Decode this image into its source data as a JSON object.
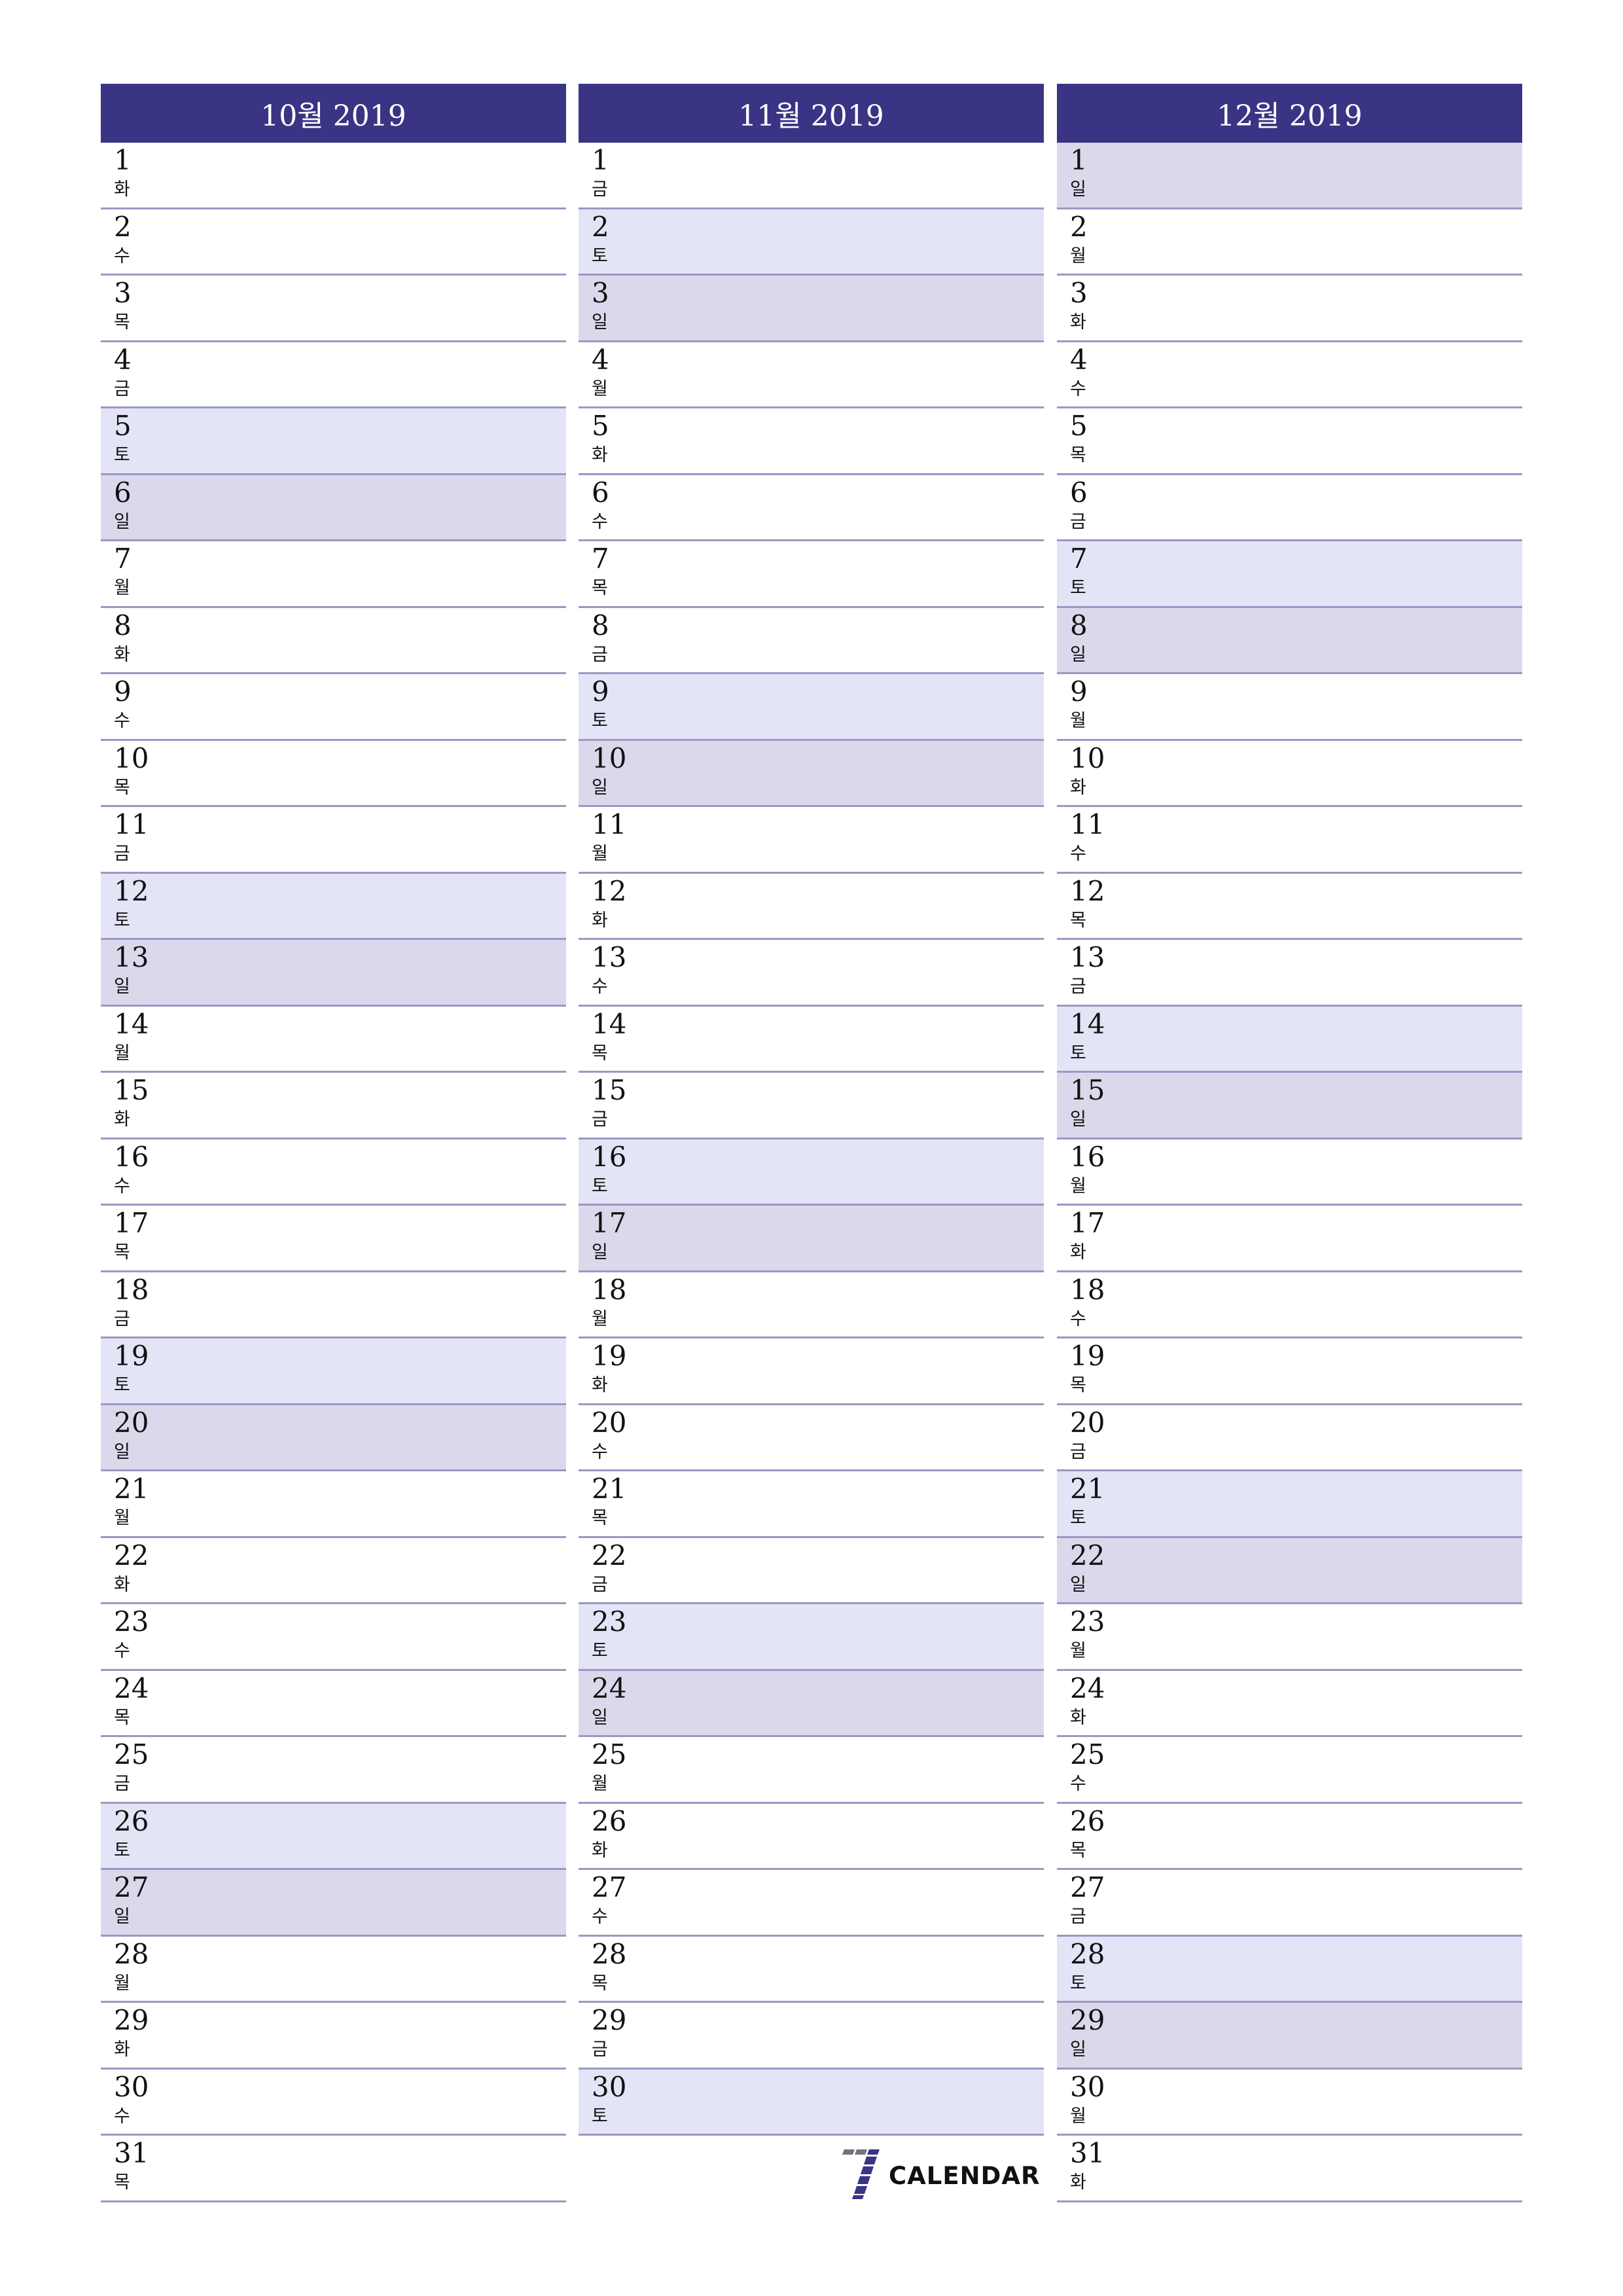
{
  "brand": {
    "text": "CALENDAR",
    "icon": "seven-logo-icon",
    "accent": "#3a3484",
    "secondary": "#77717c"
  },
  "colors": {
    "header_bg": "#3a3484",
    "saturday_bg": "#e4e4f7",
    "sunday_bg": "#dcd8ec",
    "row_border": "#9a98c4"
  },
  "months": [
    {
      "title": "10월 2019",
      "days": [
        {
          "d": "1",
          "w": "화",
          "t": "weekday"
        },
        {
          "d": "2",
          "w": "수",
          "t": "weekday"
        },
        {
          "d": "3",
          "w": "목",
          "t": "weekday"
        },
        {
          "d": "4",
          "w": "금",
          "t": "weekday"
        },
        {
          "d": "5",
          "w": "토",
          "t": "saturday"
        },
        {
          "d": "6",
          "w": "일",
          "t": "sunday"
        },
        {
          "d": "7",
          "w": "월",
          "t": "weekday"
        },
        {
          "d": "8",
          "w": "화",
          "t": "weekday"
        },
        {
          "d": "9",
          "w": "수",
          "t": "weekday"
        },
        {
          "d": "10",
          "w": "목",
          "t": "weekday"
        },
        {
          "d": "11",
          "w": "금",
          "t": "weekday"
        },
        {
          "d": "12",
          "w": "토",
          "t": "saturday"
        },
        {
          "d": "13",
          "w": "일",
          "t": "sunday"
        },
        {
          "d": "14",
          "w": "월",
          "t": "weekday"
        },
        {
          "d": "15",
          "w": "화",
          "t": "weekday"
        },
        {
          "d": "16",
          "w": "수",
          "t": "weekday"
        },
        {
          "d": "17",
          "w": "목",
          "t": "weekday"
        },
        {
          "d": "18",
          "w": "금",
          "t": "weekday"
        },
        {
          "d": "19",
          "w": "토",
          "t": "saturday"
        },
        {
          "d": "20",
          "w": "일",
          "t": "sunday"
        },
        {
          "d": "21",
          "w": "월",
          "t": "weekday"
        },
        {
          "d": "22",
          "w": "화",
          "t": "weekday"
        },
        {
          "d": "23",
          "w": "수",
          "t": "weekday"
        },
        {
          "d": "24",
          "w": "목",
          "t": "weekday"
        },
        {
          "d": "25",
          "w": "금",
          "t": "weekday"
        },
        {
          "d": "26",
          "w": "토",
          "t": "saturday"
        },
        {
          "d": "27",
          "w": "일",
          "t": "sunday"
        },
        {
          "d": "28",
          "w": "월",
          "t": "weekday"
        },
        {
          "d": "29",
          "w": "화",
          "t": "weekday"
        },
        {
          "d": "30",
          "w": "수",
          "t": "weekday"
        },
        {
          "d": "31",
          "w": "목",
          "t": "weekday"
        }
      ]
    },
    {
      "title": "11월 2019",
      "days": [
        {
          "d": "1",
          "w": "금",
          "t": "weekday"
        },
        {
          "d": "2",
          "w": "토",
          "t": "saturday"
        },
        {
          "d": "3",
          "w": "일",
          "t": "sunday"
        },
        {
          "d": "4",
          "w": "월",
          "t": "weekday"
        },
        {
          "d": "5",
          "w": "화",
          "t": "weekday"
        },
        {
          "d": "6",
          "w": "수",
          "t": "weekday"
        },
        {
          "d": "7",
          "w": "목",
          "t": "weekday"
        },
        {
          "d": "8",
          "w": "금",
          "t": "weekday"
        },
        {
          "d": "9",
          "w": "토",
          "t": "saturday"
        },
        {
          "d": "10",
          "w": "일",
          "t": "sunday"
        },
        {
          "d": "11",
          "w": "월",
          "t": "weekday"
        },
        {
          "d": "12",
          "w": "화",
          "t": "weekday"
        },
        {
          "d": "13",
          "w": "수",
          "t": "weekday"
        },
        {
          "d": "14",
          "w": "목",
          "t": "weekday"
        },
        {
          "d": "15",
          "w": "금",
          "t": "weekday"
        },
        {
          "d": "16",
          "w": "토",
          "t": "saturday"
        },
        {
          "d": "17",
          "w": "일",
          "t": "sunday"
        },
        {
          "d": "18",
          "w": "월",
          "t": "weekday"
        },
        {
          "d": "19",
          "w": "화",
          "t": "weekday"
        },
        {
          "d": "20",
          "w": "수",
          "t": "weekday"
        },
        {
          "d": "21",
          "w": "목",
          "t": "weekday"
        },
        {
          "d": "22",
          "w": "금",
          "t": "weekday"
        },
        {
          "d": "23",
          "w": "토",
          "t": "saturday"
        },
        {
          "d": "24",
          "w": "일",
          "t": "sunday"
        },
        {
          "d": "25",
          "w": "월",
          "t": "weekday"
        },
        {
          "d": "26",
          "w": "화",
          "t": "weekday"
        },
        {
          "d": "27",
          "w": "수",
          "t": "weekday"
        },
        {
          "d": "28",
          "w": "목",
          "t": "weekday"
        },
        {
          "d": "29",
          "w": "금",
          "t": "weekday"
        },
        {
          "d": "30",
          "w": "토",
          "t": "saturday"
        }
      ]
    },
    {
      "title": "12월 2019",
      "days": [
        {
          "d": "1",
          "w": "일",
          "t": "sunday"
        },
        {
          "d": "2",
          "w": "월",
          "t": "weekday"
        },
        {
          "d": "3",
          "w": "화",
          "t": "weekday"
        },
        {
          "d": "4",
          "w": "수",
          "t": "weekday"
        },
        {
          "d": "5",
          "w": "목",
          "t": "weekday"
        },
        {
          "d": "6",
          "w": "금",
          "t": "weekday"
        },
        {
          "d": "7",
          "w": "토",
          "t": "saturday"
        },
        {
          "d": "8",
          "w": "일",
          "t": "sunday"
        },
        {
          "d": "9",
          "w": "월",
          "t": "weekday"
        },
        {
          "d": "10",
          "w": "화",
          "t": "weekday"
        },
        {
          "d": "11",
          "w": "수",
          "t": "weekday"
        },
        {
          "d": "12",
          "w": "목",
          "t": "weekday"
        },
        {
          "d": "13",
          "w": "금",
          "t": "weekday"
        },
        {
          "d": "14",
          "w": "토",
          "t": "saturday"
        },
        {
          "d": "15",
          "w": "일",
          "t": "sunday"
        },
        {
          "d": "16",
          "w": "월",
          "t": "weekday"
        },
        {
          "d": "17",
          "w": "화",
          "t": "weekday"
        },
        {
          "d": "18",
          "w": "수",
          "t": "weekday"
        },
        {
          "d": "19",
          "w": "목",
          "t": "weekday"
        },
        {
          "d": "20",
          "w": "금",
          "t": "weekday"
        },
        {
          "d": "21",
          "w": "토",
          "t": "saturday"
        },
        {
          "d": "22",
          "w": "일",
          "t": "sunday"
        },
        {
          "d": "23",
          "w": "월",
          "t": "weekday"
        },
        {
          "d": "24",
          "w": "화",
          "t": "weekday"
        },
        {
          "d": "25",
          "w": "수",
          "t": "weekday"
        },
        {
          "d": "26",
          "w": "목",
          "t": "weekday"
        },
        {
          "d": "27",
          "w": "금",
          "t": "weekday"
        },
        {
          "d": "28",
          "w": "토",
          "t": "saturday"
        },
        {
          "d": "29",
          "w": "일",
          "t": "sunday"
        },
        {
          "d": "30",
          "w": "월",
          "t": "weekday"
        },
        {
          "d": "31",
          "w": "화",
          "t": "weekday"
        }
      ]
    }
  ]
}
